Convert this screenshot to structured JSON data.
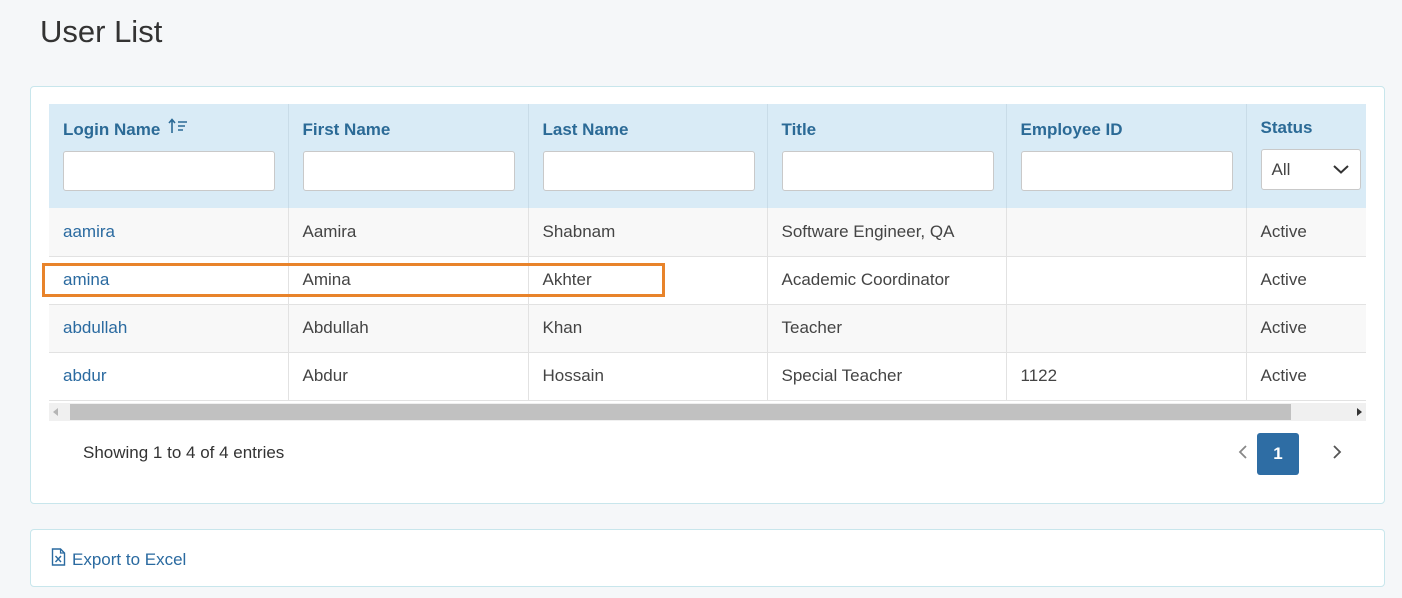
{
  "page": {
    "title": "User List"
  },
  "columns": {
    "login_name": "Login Name",
    "first_name": "First Name",
    "last_name": "Last Name",
    "title": "Title",
    "employee_id": "Employee ID",
    "status": "Status"
  },
  "filters": {
    "status_selected": "All"
  },
  "rows": [
    {
      "login": "aamira",
      "first": "Aamira",
      "last": "Shabnam",
      "title": "Software Engineer, QA",
      "employee_id": "",
      "status": "Active"
    },
    {
      "login": "amina",
      "first": "Amina",
      "last": "Akhter",
      "title": "Academic Coordinator",
      "employee_id": "",
      "status": "Active"
    },
    {
      "login": "abdullah",
      "first": "Abdullah",
      "last": "Khan",
      "title": "Teacher",
      "employee_id": "",
      "status": "Active"
    },
    {
      "login": "abdur",
      "first": "Abdur",
      "last": "Hossain",
      "title": "Special Teacher",
      "employee_id": "1122",
      "status": "Active"
    }
  ],
  "pagination": {
    "info": "Showing 1 to 4 of 4 entries",
    "current_page": "1"
  },
  "export": {
    "label": "Export to Excel"
  },
  "colors": {
    "accent": "#2e6da4",
    "link": "#2a6aa0",
    "header_bg": "#d9ebf6",
    "highlight": "#e8832a"
  },
  "icons": [
    "sort-ascending-icon",
    "chevron-down-icon",
    "chevron-left-icon",
    "chevron-right-icon",
    "excel-file-icon"
  ]
}
